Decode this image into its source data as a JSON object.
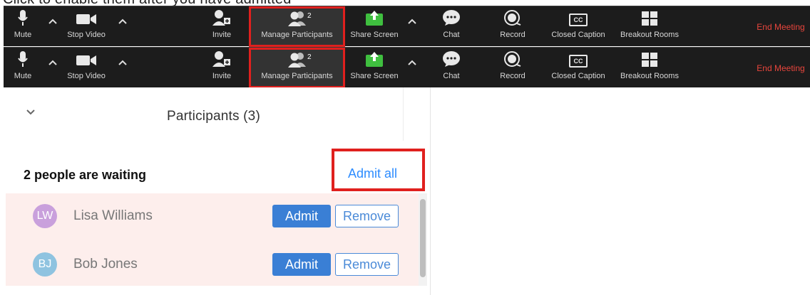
{
  "caption": "Click to enable them after you have admitted",
  "toolbar": {
    "mute_label": "Mute",
    "stop_video_label": "Stop Video",
    "invite_label": "Invite",
    "manage_participants_label": "Manage Participants",
    "participant_count": "2",
    "share_screen_label": "Share Screen",
    "chat_label": "Chat",
    "record_label": "Record",
    "closed_caption_label": "Closed Caption",
    "breakout_rooms_label": "Breakout Rooms",
    "end_meeting_label": "End Meeting",
    "cc_badge": "CC",
    "colors": {
      "background": "#1c1c1c",
      "highlight": "#e0201e",
      "share_green": "#3fbf3f",
      "end_red": "#e8453c"
    }
  },
  "participants_panel": {
    "title": "Participants (3)",
    "waiting_text": "2 people are waiting",
    "admit_all_label": "Admit all",
    "waiting_list": [
      {
        "initials": "LW",
        "name": "Lisa Williams",
        "avatar_color": "#c9a0dc",
        "admit_label": "Admit",
        "remove_label": "Remove"
      },
      {
        "initials": "BJ",
        "name": "Bob Jones",
        "avatar_color": "#8fc3e0",
        "admit_label": "Admit",
        "remove_label": "Remove"
      }
    ],
    "colors": {
      "accent": "#2d8cff",
      "admit_button": "#3a7fd5",
      "list_background": "#fdeeec"
    }
  }
}
